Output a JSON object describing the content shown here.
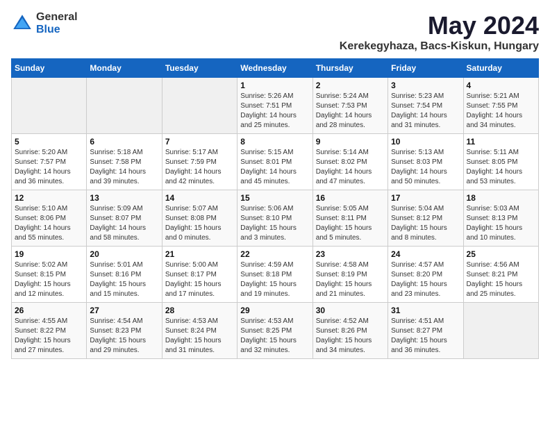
{
  "logo": {
    "general": "General",
    "blue": "Blue"
  },
  "title": "May 2024",
  "subtitle": "Kerekegyhaza, Bacs-Kiskun, Hungary",
  "headers": [
    "Sunday",
    "Monday",
    "Tuesday",
    "Wednesday",
    "Thursday",
    "Friday",
    "Saturday"
  ],
  "weeks": [
    [
      {
        "day": "",
        "sunrise": "",
        "sunset": "",
        "daylight": ""
      },
      {
        "day": "",
        "sunrise": "",
        "sunset": "",
        "daylight": ""
      },
      {
        "day": "",
        "sunrise": "",
        "sunset": "",
        "daylight": ""
      },
      {
        "day": "1",
        "sunrise": "Sunrise: 5:26 AM",
        "sunset": "Sunset: 7:51 PM",
        "daylight": "Daylight: 14 hours and 25 minutes."
      },
      {
        "day": "2",
        "sunrise": "Sunrise: 5:24 AM",
        "sunset": "Sunset: 7:53 PM",
        "daylight": "Daylight: 14 hours and 28 minutes."
      },
      {
        "day": "3",
        "sunrise": "Sunrise: 5:23 AM",
        "sunset": "Sunset: 7:54 PM",
        "daylight": "Daylight: 14 hours and 31 minutes."
      },
      {
        "day": "4",
        "sunrise": "Sunrise: 5:21 AM",
        "sunset": "Sunset: 7:55 PM",
        "daylight": "Daylight: 14 hours and 34 minutes."
      }
    ],
    [
      {
        "day": "5",
        "sunrise": "Sunrise: 5:20 AM",
        "sunset": "Sunset: 7:57 PM",
        "daylight": "Daylight: 14 hours and 36 minutes."
      },
      {
        "day": "6",
        "sunrise": "Sunrise: 5:18 AM",
        "sunset": "Sunset: 7:58 PM",
        "daylight": "Daylight: 14 hours and 39 minutes."
      },
      {
        "day": "7",
        "sunrise": "Sunrise: 5:17 AM",
        "sunset": "Sunset: 7:59 PM",
        "daylight": "Daylight: 14 hours and 42 minutes."
      },
      {
        "day": "8",
        "sunrise": "Sunrise: 5:15 AM",
        "sunset": "Sunset: 8:01 PM",
        "daylight": "Daylight: 14 hours and 45 minutes."
      },
      {
        "day": "9",
        "sunrise": "Sunrise: 5:14 AM",
        "sunset": "Sunset: 8:02 PM",
        "daylight": "Daylight: 14 hours and 47 minutes."
      },
      {
        "day": "10",
        "sunrise": "Sunrise: 5:13 AM",
        "sunset": "Sunset: 8:03 PM",
        "daylight": "Daylight: 14 hours and 50 minutes."
      },
      {
        "day": "11",
        "sunrise": "Sunrise: 5:11 AM",
        "sunset": "Sunset: 8:05 PM",
        "daylight": "Daylight: 14 hours and 53 minutes."
      }
    ],
    [
      {
        "day": "12",
        "sunrise": "Sunrise: 5:10 AM",
        "sunset": "Sunset: 8:06 PM",
        "daylight": "Daylight: 14 hours and 55 minutes."
      },
      {
        "day": "13",
        "sunrise": "Sunrise: 5:09 AM",
        "sunset": "Sunset: 8:07 PM",
        "daylight": "Daylight: 14 hours and 58 minutes."
      },
      {
        "day": "14",
        "sunrise": "Sunrise: 5:07 AM",
        "sunset": "Sunset: 8:08 PM",
        "daylight": "Daylight: 15 hours and 0 minutes."
      },
      {
        "day": "15",
        "sunrise": "Sunrise: 5:06 AM",
        "sunset": "Sunset: 8:10 PM",
        "daylight": "Daylight: 15 hours and 3 minutes."
      },
      {
        "day": "16",
        "sunrise": "Sunrise: 5:05 AM",
        "sunset": "Sunset: 8:11 PM",
        "daylight": "Daylight: 15 hours and 5 minutes."
      },
      {
        "day": "17",
        "sunrise": "Sunrise: 5:04 AM",
        "sunset": "Sunset: 8:12 PM",
        "daylight": "Daylight: 15 hours and 8 minutes."
      },
      {
        "day": "18",
        "sunrise": "Sunrise: 5:03 AM",
        "sunset": "Sunset: 8:13 PM",
        "daylight": "Daylight: 15 hours and 10 minutes."
      }
    ],
    [
      {
        "day": "19",
        "sunrise": "Sunrise: 5:02 AM",
        "sunset": "Sunset: 8:15 PM",
        "daylight": "Daylight: 15 hours and 12 minutes."
      },
      {
        "day": "20",
        "sunrise": "Sunrise: 5:01 AM",
        "sunset": "Sunset: 8:16 PM",
        "daylight": "Daylight: 15 hours and 15 minutes."
      },
      {
        "day": "21",
        "sunrise": "Sunrise: 5:00 AM",
        "sunset": "Sunset: 8:17 PM",
        "daylight": "Daylight: 15 hours and 17 minutes."
      },
      {
        "day": "22",
        "sunrise": "Sunrise: 4:59 AM",
        "sunset": "Sunset: 8:18 PM",
        "daylight": "Daylight: 15 hours and 19 minutes."
      },
      {
        "day": "23",
        "sunrise": "Sunrise: 4:58 AM",
        "sunset": "Sunset: 8:19 PM",
        "daylight": "Daylight: 15 hours and 21 minutes."
      },
      {
        "day": "24",
        "sunrise": "Sunrise: 4:57 AM",
        "sunset": "Sunset: 8:20 PM",
        "daylight": "Daylight: 15 hours and 23 minutes."
      },
      {
        "day": "25",
        "sunrise": "Sunrise: 4:56 AM",
        "sunset": "Sunset: 8:21 PM",
        "daylight": "Daylight: 15 hours and 25 minutes."
      }
    ],
    [
      {
        "day": "26",
        "sunrise": "Sunrise: 4:55 AM",
        "sunset": "Sunset: 8:22 PM",
        "daylight": "Daylight: 15 hours and 27 minutes."
      },
      {
        "day": "27",
        "sunrise": "Sunrise: 4:54 AM",
        "sunset": "Sunset: 8:23 PM",
        "daylight": "Daylight: 15 hours and 29 minutes."
      },
      {
        "day": "28",
        "sunrise": "Sunrise: 4:53 AM",
        "sunset": "Sunset: 8:24 PM",
        "daylight": "Daylight: 15 hours and 31 minutes."
      },
      {
        "day": "29",
        "sunrise": "Sunrise: 4:53 AM",
        "sunset": "Sunset: 8:25 PM",
        "daylight": "Daylight: 15 hours and 32 minutes."
      },
      {
        "day": "30",
        "sunrise": "Sunrise: 4:52 AM",
        "sunset": "Sunset: 8:26 PM",
        "daylight": "Daylight: 15 hours and 34 minutes."
      },
      {
        "day": "31",
        "sunrise": "Sunrise: 4:51 AM",
        "sunset": "Sunset: 8:27 PM",
        "daylight": "Daylight: 15 hours and 36 minutes."
      },
      {
        "day": "",
        "sunrise": "",
        "sunset": "",
        "daylight": ""
      }
    ]
  ]
}
